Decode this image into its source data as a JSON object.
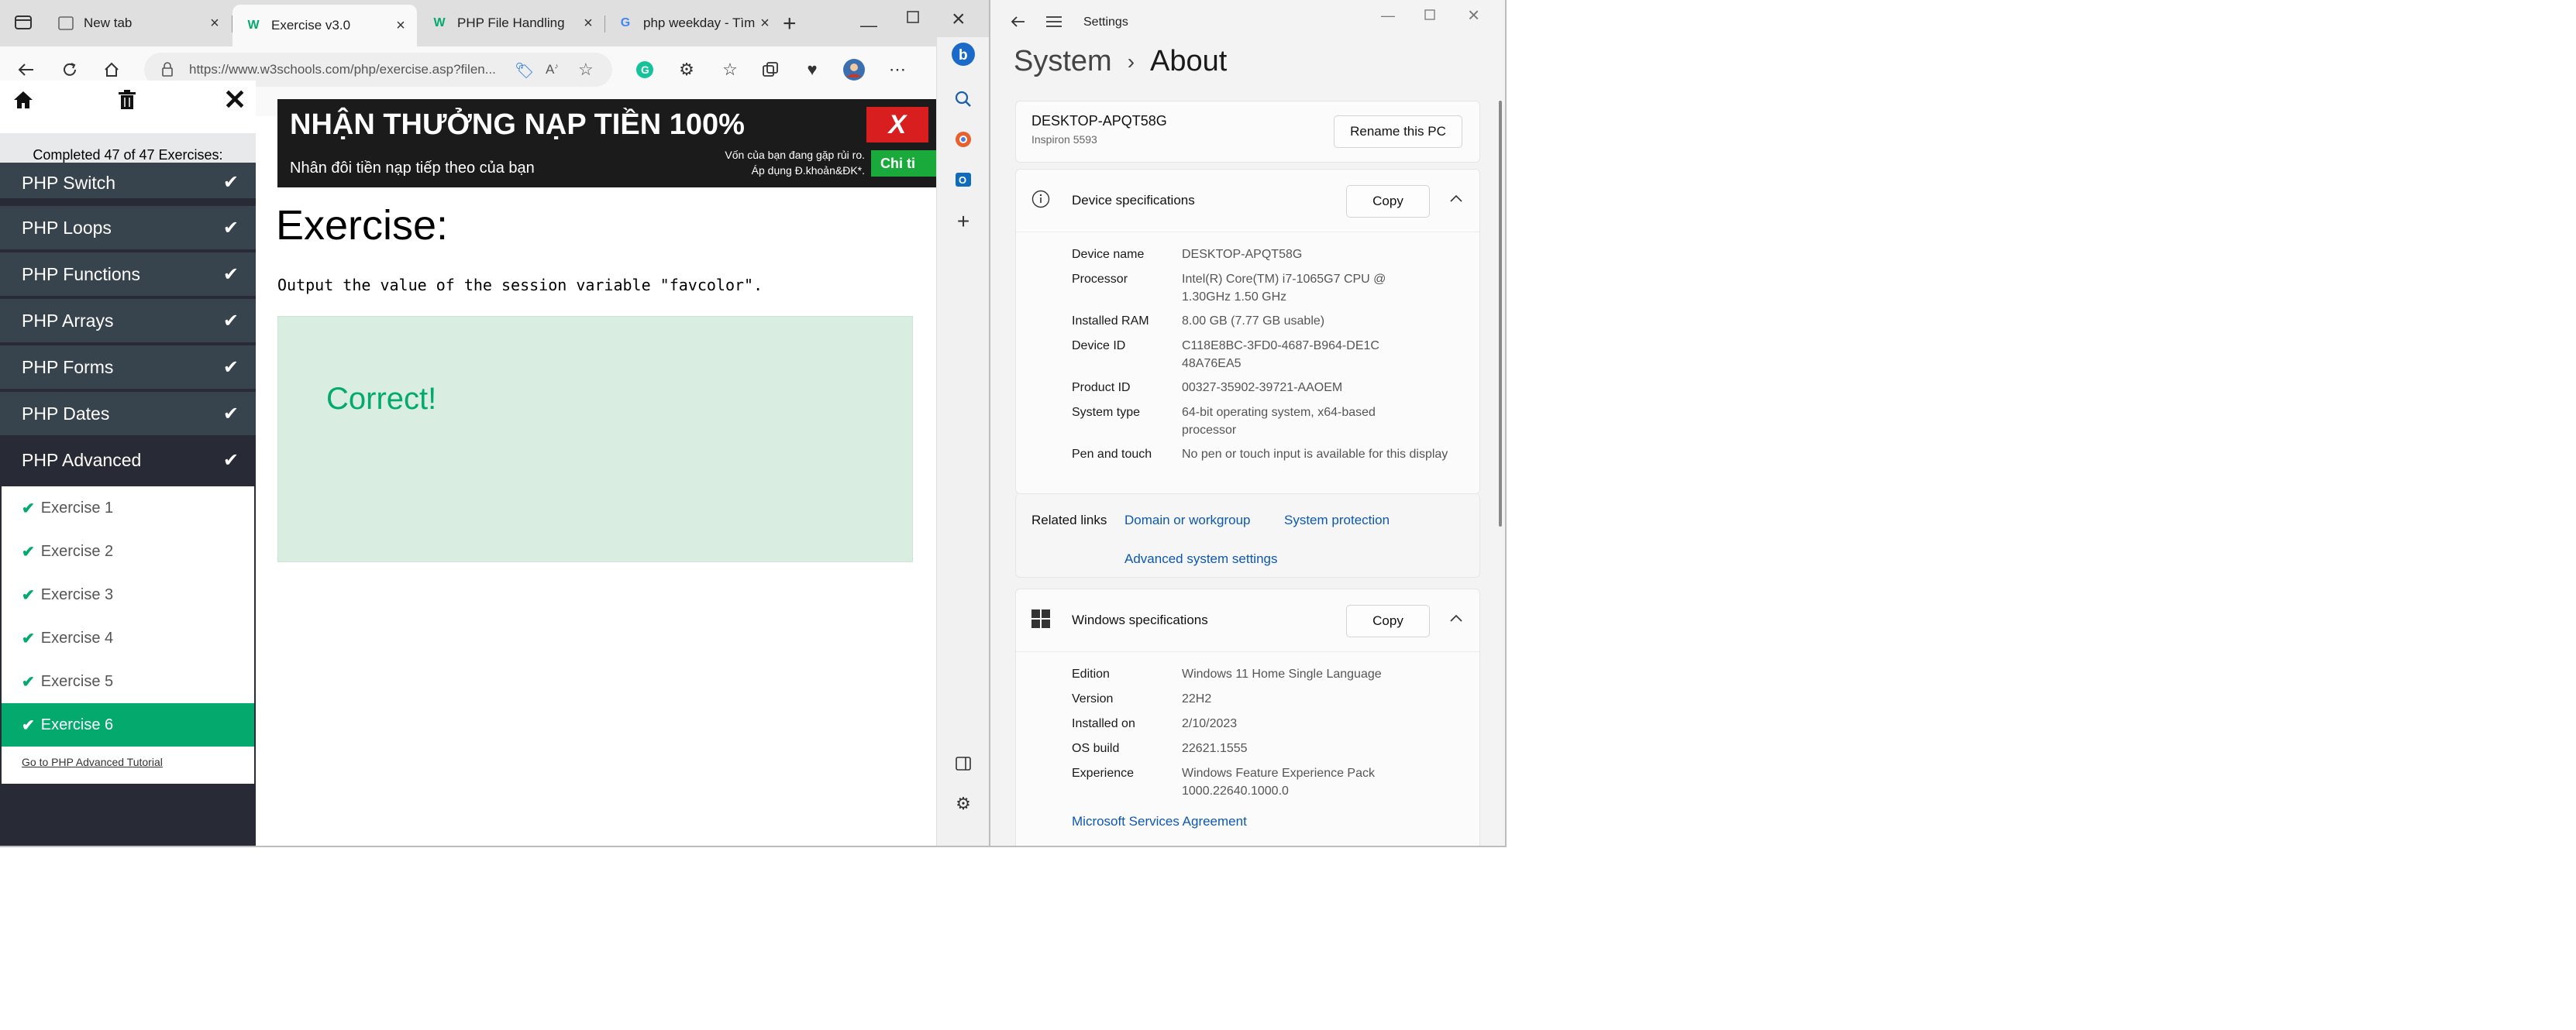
{
  "browser": {
    "tabs": [
      {
        "title": "New tab",
        "favicon": "new-tab-icon"
      },
      {
        "title": "Exercise v3.0",
        "favicon": "w3schools-icon"
      },
      {
        "title": "PHP File Handling",
        "favicon": "w3schools-icon"
      },
      {
        "title": "php weekday - Tìm trê",
        "favicon": "google-icon"
      }
    ],
    "url": "https://www.w3schools.com/php/exercise.asp?filen..."
  },
  "w3": {
    "completed": "Completed 47 of 47 Exercises:",
    "categories": [
      "PHP Switch",
      "PHP Loops",
      "PHP Functions",
      "PHP Arrays",
      "PHP Forms",
      "PHP Dates",
      "PHP Advanced"
    ],
    "exercises": [
      "Exercise 1",
      "Exercise 2",
      "Exercise 3",
      "Exercise 4",
      "Exercise 5",
      "Exercise 6"
    ],
    "goto": "Go to PHP Advanced Tutorial",
    "banner": {
      "title": "NHẬN THƯỞNG NẠP TIỀN 100%",
      "subtitle": "Nhân đôi tiền nạp tiếp theo của bạn",
      "note1": "Vốn của bạn đang gặp rủi ro.",
      "note2": "Áp dụng Đ.khoản&ĐK*.",
      "logo": "X",
      "cta": "Chi ti"
    },
    "heading": "Exercise:",
    "question": "Output the value of the session variable \"favcolor\".",
    "result": "Correct!",
    "accent": "#04aa6d"
  },
  "settings": {
    "window_title": "Settings",
    "breadcrumb": {
      "parent": "System",
      "sep": "›",
      "current": "About"
    },
    "device_name_big": "DESKTOP-APQT58G",
    "model": "Inspiron 5593",
    "rename": "Rename this PC",
    "device_specs": {
      "title": "Device specifications",
      "copy": "Copy",
      "rows": [
        {
          "k": "Device name",
          "v": "DESKTOP-APQT58G"
        },
        {
          "k": "Processor",
          "v": "Intel(R) Core(TM) i7-1065G7 CPU @ 1.30GHz   1.50 GHz"
        },
        {
          "k": "Installed RAM",
          "v": "8.00 GB (7.77 GB usable)"
        },
        {
          "k": "Device ID",
          "v": "C118E8BC-3FD0-4687-B964-DE1C48A76EA5"
        },
        {
          "k": "Product ID",
          "v": "00327-35902-39721-AAOEM"
        },
        {
          "k": "System type",
          "v": "64-bit operating system, x64-based processor"
        },
        {
          "k": "Pen and touch",
          "v": "No pen or touch input is available for this display"
        }
      ]
    },
    "related": {
      "label": "Related links",
      "links": [
        "Domain or workgroup",
        "System protection",
        "Advanced system settings"
      ]
    },
    "windows_specs": {
      "title": "Windows specifications",
      "copy": "Copy",
      "rows": [
        {
          "k": "Edition",
          "v": "Windows 11 Home Single Language"
        },
        {
          "k": "Version",
          "v": "22H2"
        },
        {
          "k": "Installed on",
          "v": "2/10/2023"
        },
        {
          "k": "OS build",
          "v": "22621.1555"
        },
        {
          "k": "Experience",
          "v": "Windows Feature Experience Pack 1000.22640.1000.0"
        }
      ],
      "link": "Microsoft Services Agreement"
    }
  }
}
